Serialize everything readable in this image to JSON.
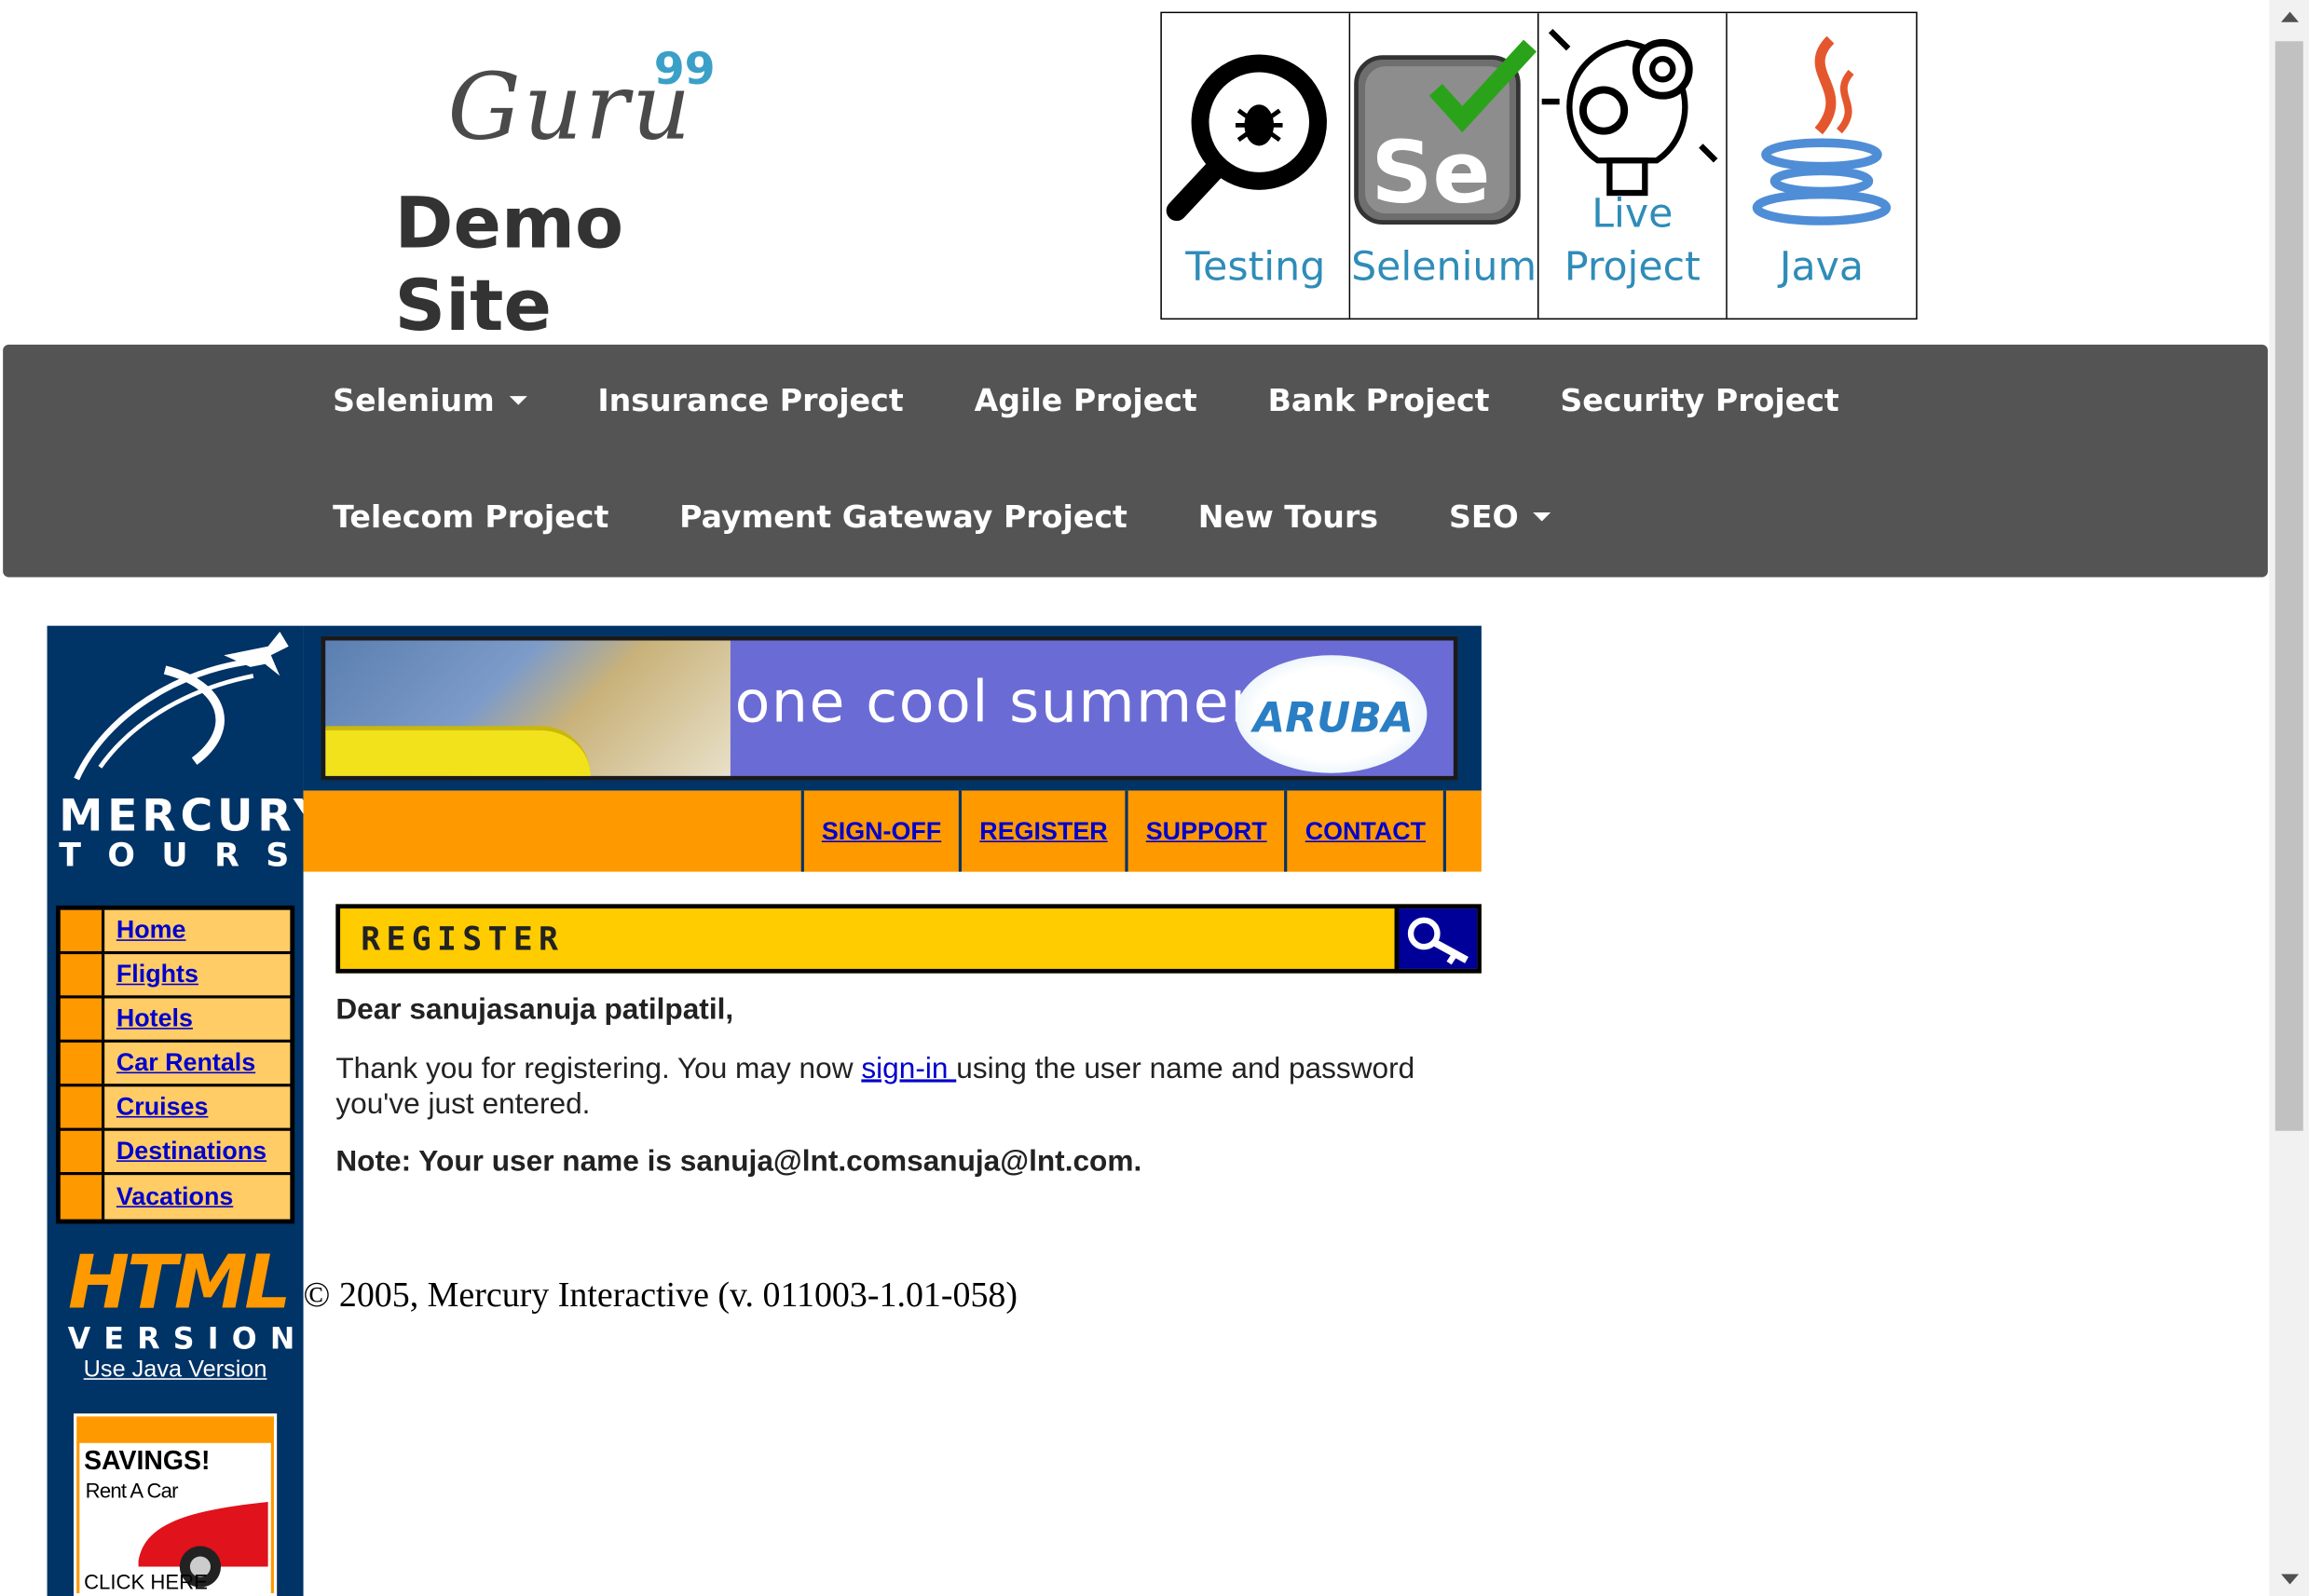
{
  "header": {
    "logo_word": "Guru",
    "logo_sup": "99",
    "logo_sub": "Demo Site",
    "tiles": [
      {
        "label": "Testing",
        "icon": "magnifier-bug-icon"
      },
      {
        "label": "Selenium",
        "icon": "selenium-icon"
      },
      {
        "label": "Live Project",
        "icon": "lightbulb-gears-icon"
      },
      {
        "label": "Java",
        "icon": "java-icon"
      }
    ]
  },
  "nav": {
    "row1": [
      "Selenium",
      "Insurance Project",
      "Agile Project",
      "Bank Project",
      "Security Project"
    ],
    "row2": [
      "Telecom Project",
      "Payment Gateway Project",
      "New Tours",
      "SEO"
    ]
  },
  "mercury": {
    "brand_top": "MERCURY",
    "brand_bottom": "TOURS",
    "banner_text": "one cool summer",
    "banner_badge": "ARUBA",
    "top_links": [
      "SIGN-OFF",
      "REGISTER",
      "SUPPORT",
      "CONTACT"
    ],
    "side_links": [
      "Home",
      "Flights",
      "Hotels",
      "Car Rentals",
      "Cruises",
      "Destinations",
      "Vacations"
    ],
    "html_version_big": "HTML",
    "html_version_small": "VERSION",
    "java_version_link": "Use Java Version",
    "ad": {
      "title": "SAVINGS!",
      "subtitle": "Rent A Car",
      "cta": "CLICK HERE"
    },
    "section_title": "REGISTER",
    "greeting": "Dear sanujasanuja patilpatil,",
    "thanks_before": "Thank you for registering. You may now ",
    "thanks_link": "sign-in ",
    "thanks_after": "using the user name and password you've just entered.",
    "note": "Note: Your user name is sanuja@lnt.comsanuja@lnt.com.",
    "copyright": "© 2005, Mercury Interactive (v. 011003-1.01-058)"
  },
  "colors": {
    "nav_bg": "#545454",
    "mercury_navy": "#003366",
    "mercury_orange": "#ff9900",
    "mercury_yellow": "#ffcc00",
    "link_blue": "#0000cc",
    "tile_text": "#2f8cb8"
  }
}
